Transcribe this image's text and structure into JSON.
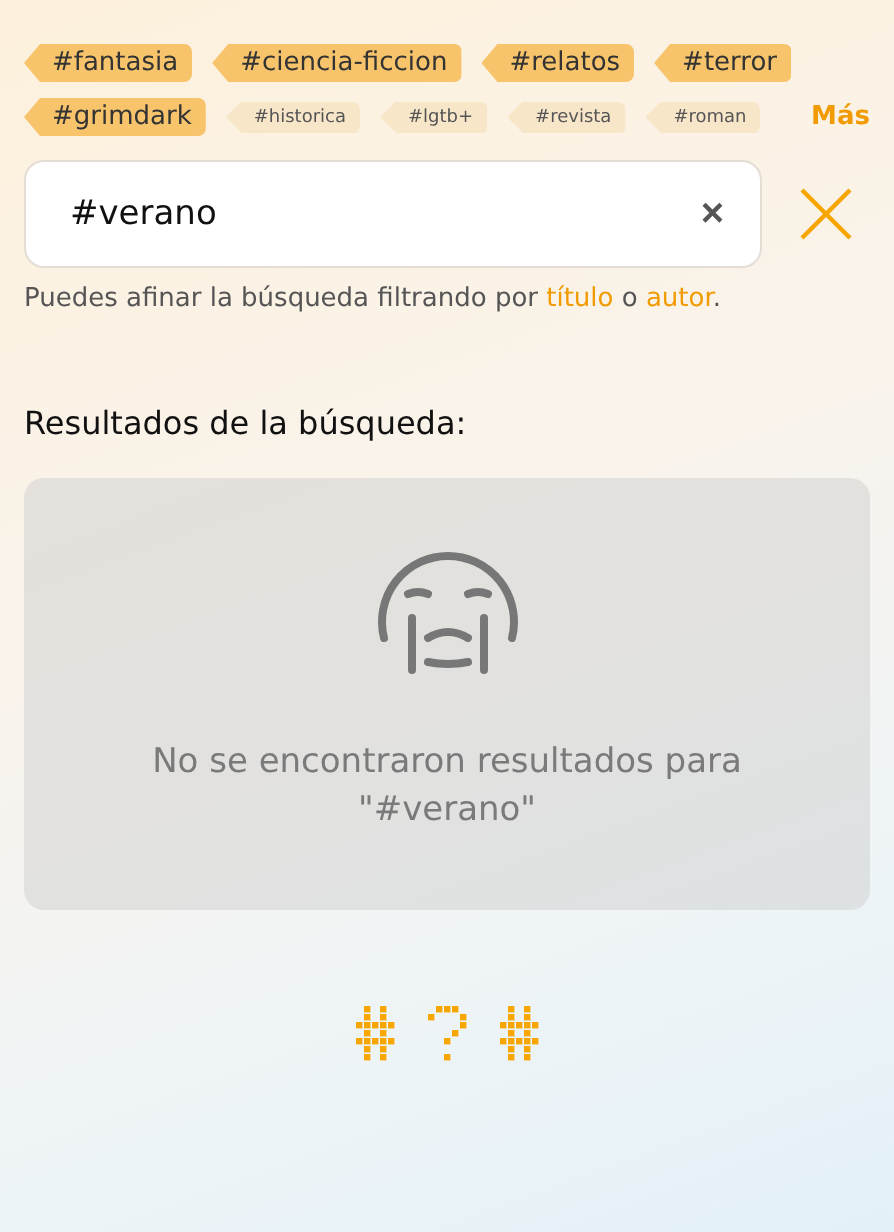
{
  "tags": [
    {
      "label": "#fantasia",
      "selected": true
    },
    {
      "label": "#ciencia-ficcion",
      "selected": true
    },
    {
      "label": "#relatos",
      "selected": true
    },
    {
      "label": "#terror",
      "selected": true
    },
    {
      "label": "#grimdark",
      "selected": true
    },
    {
      "label": "#historica",
      "selected": false
    },
    {
      "label": "#lgtb+",
      "selected": false
    },
    {
      "label": "#revista",
      "selected": false
    },
    {
      "label": "#roman",
      "selected": false
    }
  ],
  "more_link": "Más",
  "search": {
    "value": "#verano",
    "clear_icon": "×"
  },
  "hint": [
    {
      "kind": "text",
      "text": "Puedes afinar la búsqueda filtrando por "
    },
    {
      "kind": "link",
      "text": "título"
    },
    {
      "kind": "text",
      "text": " o "
    },
    {
      "kind": "link",
      "text": "autor"
    },
    {
      "kind": "text",
      "text": "."
    }
  ],
  "results": {
    "heading": "Resultados de la búsqueda:",
    "empty_message": "No se encontraron resultados para \"#verano\""
  }
}
